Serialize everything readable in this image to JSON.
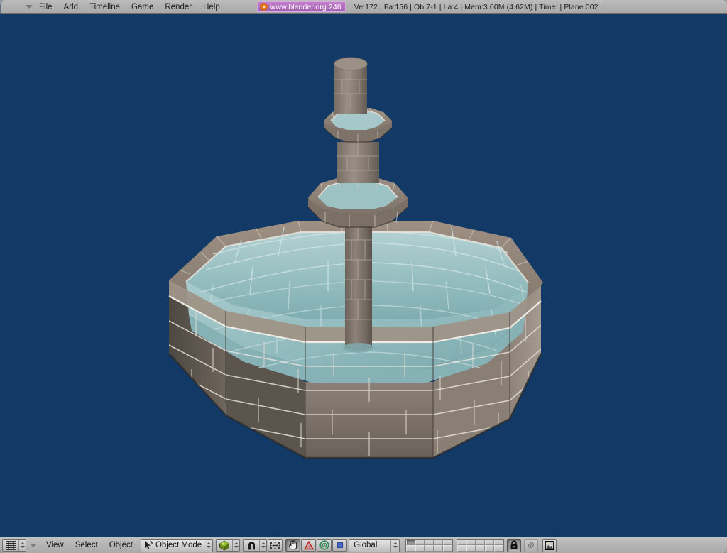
{
  "app": {
    "name": "Blender",
    "viewport_bg": "#133966"
  },
  "header": {
    "editor_type_icon": "chevron-down-icon",
    "menus": [
      {
        "label": "File"
      },
      {
        "label": "Add"
      },
      {
        "label": "Timeline"
      },
      {
        "label": "Game"
      },
      {
        "label": "Render"
      },
      {
        "label": "Help"
      }
    ],
    "badge": {
      "icon": "blender-logo-icon",
      "text": "www.blender.org 246",
      "bg_color": "#b36fc0",
      "text_color": "#ffffff"
    },
    "stats": "Ve:172 | Fa:156 | Ob:7-1 | La:4  | Mem:3.00M (4.62M)  | Time: | Plane.002",
    "stats_parts": {
      "vertices": "Ve:172",
      "faces": "Fa:156",
      "objects": "Ob:7-1",
      "lamps": "La:4",
      "memory": "Mem:3.00M (4.62M)",
      "time": "Time:",
      "active_object": "Plane.002"
    }
  },
  "footer": {
    "editor_type_icon": "grid-3dview-icon",
    "view_menu_arrow_icon": "chevron-down-icon",
    "menus": [
      {
        "label": "View"
      },
      {
        "label": "Select"
      },
      {
        "label": "Object"
      }
    ],
    "mode": {
      "icon": "object-mode-cursor-icon",
      "label": "Object Mode",
      "spinner_icon": "spinner-updown-icon"
    },
    "draw_type": {
      "icon": "textured-shading-sphere-icon",
      "spinner_icon": "spinner-updown-icon"
    },
    "snap": {
      "icon": "magnet-icon",
      "spinner_icon": "spinner-updown-icon"
    },
    "proportional_edit": {
      "icon": "proportional-edit-icon"
    },
    "manipulator": {
      "translate_icon": "hand-translate-icon",
      "rotate_icon": "rotate-triangle-icon",
      "scale_icon": "scale-circle-icon",
      "extra_icon": "blue-square-icon",
      "translate_active": true
    },
    "transform_orientation": {
      "label": "Global",
      "spinner_icon": "spinner-updown-icon"
    },
    "layers": {
      "rows": 2,
      "cols_per_group": 5,
      "groups": 2,
      "active_index": 0
    },
    "lock_button": {
      "icon": "lock-closed-icon"
    },
    "link_button": {
      "icon": "link-chain-icon",
      "dimmed": true
    },
    "render_button": {
      "icon": "render-image-icon"
    }
  },
  "scene": {
    "description": "Textured 3D fountain model in solid/textured shading over dark blue viewport background",
    "object_name": "Plane.002",
    "colors": {
      "background": "#133966",
      "water_light": "#a9cbcd",
      "water_mid": "#8fb8bb",
      "water_dark": "#7aa8ac",
      "stone_light": "#b8ada1",
      "stone_mid": "#93887e",
      "stone_dark": "#6d655e",
      "stone_shadow": "#4b4641",
      "mortar": "#e8e4de"
    }
  }
}
